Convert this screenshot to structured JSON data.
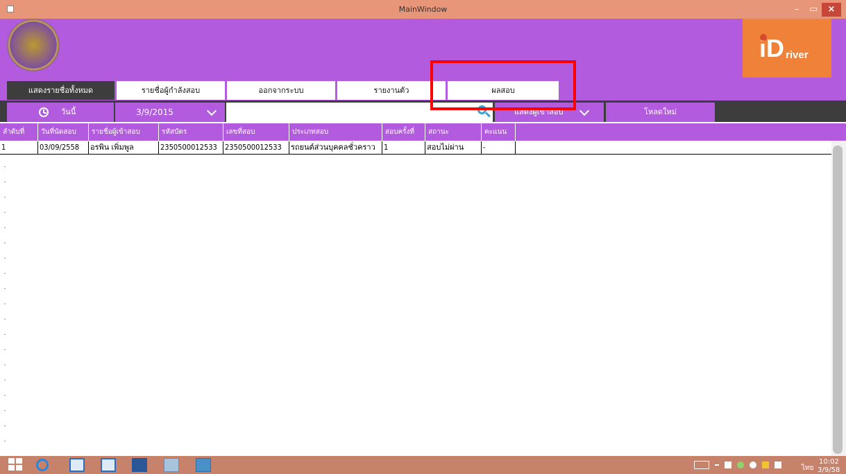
{
  "window": {
    "title": "MainWindow",
    "minimize": "–",
    "maximize": "▭",
    "close": "×"
  },
  "logo": {
    "i": "i",
    "big_d": "D",
    "text": "river"
  },
  "tabs": [
    {
      "label": "แสดงรายชื่อทั้งหมด"
    },
    {
      "label": "รายชื่อผู้กำลังสอบ"
    },
    {
      "label": "ออกจากระบบ"
    },
    {
      "label": "รายงานตัว"
    },
    {
      "label": "ผลสอบ"
    }
  ],
  "filter": {
    "today_label": "วันนี้",
    "date_value": "3/9/2015",
    "search_placeholder": "",
    "status_filter_value": "แสดงผู้เข้าสอบ",
    "reload_label": "โหลดใหม่"
  },
  "table": {
    "columns": [
      "ลำดับที่",
      "วันที่นัดสอบ",
      "รายชื่อผู้เข้าสอบ",
      "รหัสบัตร",
      "เลขที่สอบ",
      "ประเภทสอบ",
      "สอบครั้งที่",
      "สถานะ",
      "คะแนน"
    ],
    "rows": [
      [
        "1",
        "03/09/2558",
        "อรพิน  เพิ่มพูล",
        "2350500012533",
        "2350500012533",
        "รถยนต์ส่วนบุคคลชั่วคราว",
        "1",
        "สอบไม่ผ่าน",
        "-"
      ]
    ]
  },
  "taskbar": {
    "time": "10:02",
    "date": "3/9/58",
    "lang": "ไทย"
  },
  "colors": {
    "header": "#b25bde",
    "dark": "#3d3d3d",
    "titlebar": "#e8967a",
    "logo_bg": "#f08138",
    "highlight": "#ff0000"
  }
}
